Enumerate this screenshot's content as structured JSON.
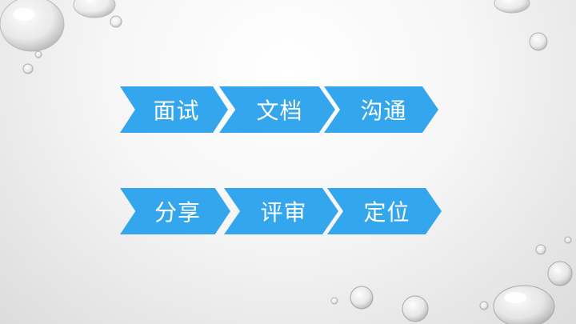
{
  "slide": {
    "row1": {
      "items": [
        "面试",
        "文档",
        "沟通"
      ]
    },
    "row2": {
      "items": [
        "分享",
        "评审",
        "定位"
      ]
    }
  },
  "colors": {
    "chevron": "#34a6ee",
    "text": "#ffffff",
    "background": "#f2f2f2"
  },
  "decor": {
    "drop_icon": "water-droplet-icon"
  }
}
